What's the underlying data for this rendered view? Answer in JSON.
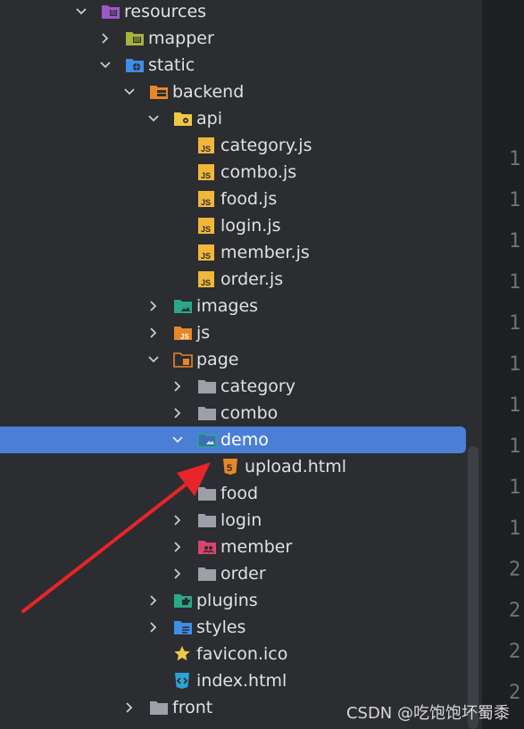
{
  "tree": {
    "rows": [
      {
        "label": "resources",
        "icon": "resources-folder-icon",
        "chevron": "down"
      },
      {
        "label": "mapper",
        "icon": "mapper-folder-icon",
        "chevron": "right"
      },
      {
        "label": "static",
        "icon": "static-web-folder-icon",
        "chevron": "down"
      },
      {
        "label": "backend",
        "icon": "backend-folder-icon",
        "chevron": "down"
      },
      {
        "label": "api",
        "icon": "api-folder-icon",
        "chevron": "down"
      },
      {
        "label": "category.js",
        "icon": "js-file-icon",
        "chevron": ""
      },
      {
        "label": "combo.js",
        "icon": "js-file-icon",
        "chevron": ""
      },
      {
        "label": "food.js",
        "icon": "js-file-icon",
        "chevron": ""
      },
      {
        "label": "login.js",
        "icon": "js-file-icon",
        "chevron": ""
      },
      {
        "label": "member.js",
        "icon": "js-file-icon",
        "chevron": ""
      },
      {
        "label": "order.js",
        "icon": "js-file-icon",
        "chevron": ""
      },
      {
        "label": "images",
        "icon": "images-folder-icon",
        "chevron": "right"
      },
      {
        "label": "js",
        "icon": "js-folder-icon",
        "chevron": "right"
      },
      {
        "label": "page",
        "icon": "page-folder-icon",
        "chevron": "down"
      },
      {
        "label": "category",
        "icon": "folder-icon",
        "chevron": "right"
      },
      {
        "label": "combo",
        "icon": "folder-icon",
        "chevron": "right"
      },
      {
        "label": "demo",
        "icon": "demo-folder-icon",
        "chevron": "down"
      },
      {
        "label": "upload.html",
        "icon": "html5-file-icon",
        "chevron": ""
      },
      {
        "label": "food",
        "icon": "folder-icon",
        "chevron": ""
      },
      {
        "label": "login",
        "icon": "folder-icon",
        "chevron": "right"
      },
      {
        "label": "member",
        "icon": "member-folder-icon",
        "chevron": "right"
      },
      {
        "label": "order",
        "icon": "folder-icon",
        "chevron": "right"
      },
      {
        "label": "plugins",
        "icon": "plugins-folder-icon",
        "chevron": "right"
      },
      {
        "label": "styles",
        "icon": "styles-folder-icon",
        "chevron": "right"
      },
      {
        "label": "favicon.ico",
        "icon": "star-icon",
        "chevron": ""
      },
      {
        "label": "index.html",
        "icon": "html-file-icon",
        "chevron": ""
      },
      {
        "label": "front",
        "icon": "folder-icon",
        "chevron": "right"
      }
    ],
    "selected_label": "demo"
  },
  "editor": {
    "line_numbers": [
      "1",
      "1",
      "1",
      "1",
      "1",
      "1",
      "1",
      "1",
      "1",
      "1",
      "2",
      "2",
      "2",
      "2"
    ]
  },
  "watermark": "CSDN @吃饱饱坏蜀黍",
  "colors": {
    "selection": "#4b7fd6",
    "background": "#2b2d30",
    "arrow": "#e8232a"
  }
}
